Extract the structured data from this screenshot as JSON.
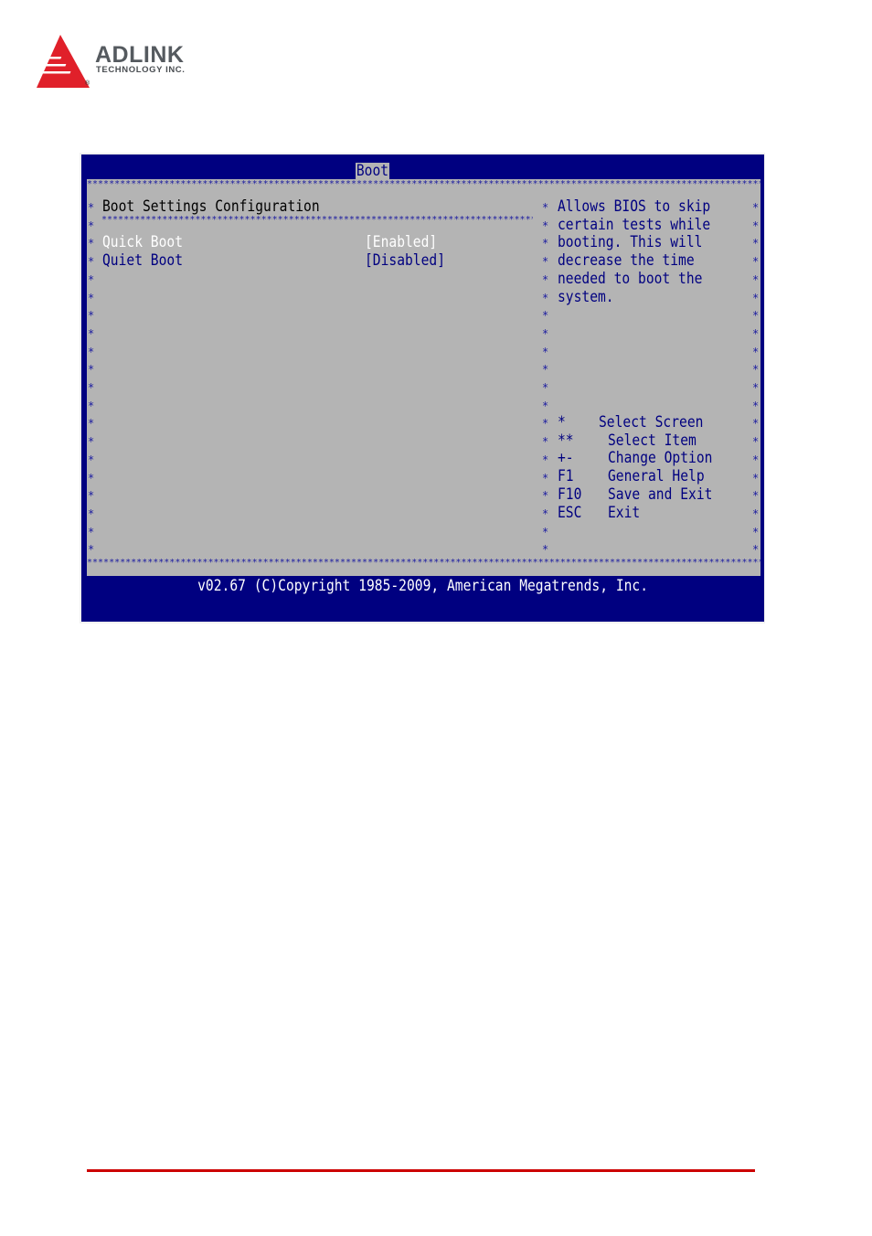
{
  "brand": {
    "name": "ADLINK",
    "subtitle": "TECHNOLOGY INC.",
    "registered_mark": "®",
    "logo_color": "#e0202a"
  },
  "bios": {
    "active_tab": "Boot",
    "section_title": "Boot Settings Configuration",
    "items": [
      {
        "label": "Quick Boot",
        "value": "[Enabled]",
        "selected": true
      },
      {
        "label": "Quiet Boot",
        "value": "[Disabled]",
        "selected": false
      }
    ],
    "help_text": [
      "Allows BIOS to skip",
      "certain tests while",
      "booting. This will",
      "decrease the time",
      "needed to boot the",
      "system."
    ],
    "key_legend": [
      {
        "key": "*",
        "action": "Select Screen"
      },
      {
        "key": "**",
        "action": "Select Item"
      },
      {
        "key": "+-",
        "action": "Change Option"
      },
      {
        "key": "F1",
        "action": "General Help"
      },
      {
        "key": "F10",
        "action": "Save and Exit"
      },
      {
        "key": "ESC",
        "action": "Exit"
      }
    ],
    "footer": "v02.67 (C)Copyright 1985-2009, American Megatrends, Inc.",
    "colors": {
      "background": "#000080",
      "panel": "#b4b4b4",
      "text": "#000080",
      "selected_text": "#ffffff"
    }
  },
  "page": {
    "rule_color": "#cc0000"
  }
}
